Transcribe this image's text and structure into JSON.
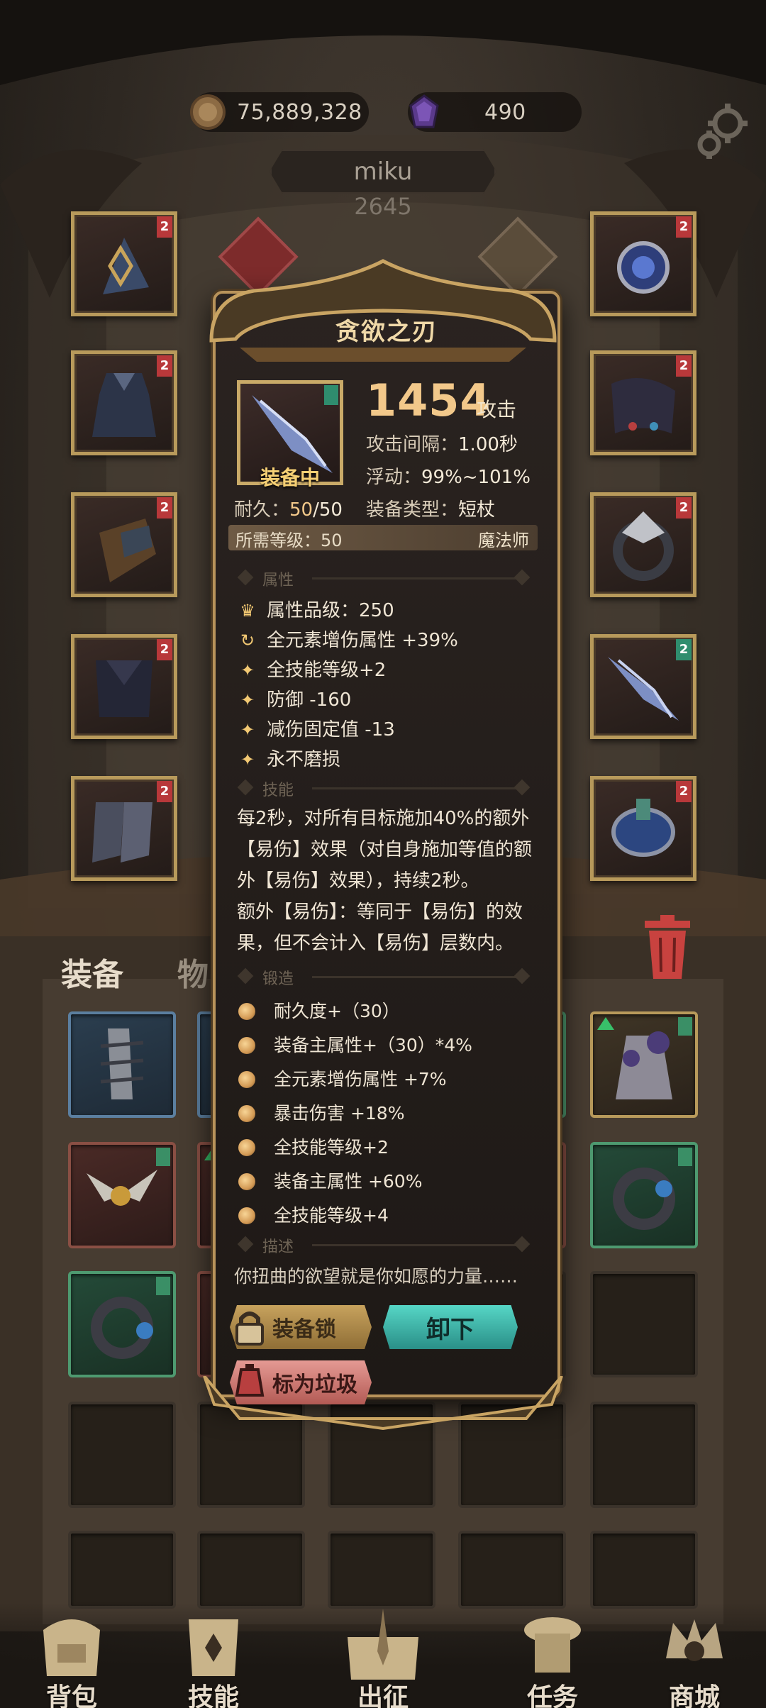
{
  "topbar": {
    "gold_amount": "75,889,328",
    "gem_amount": "490",
    "icons": [
      "gold-coin-icon",
      "purple-gem-icon",
      "gear-icon"
    ]
  },
  "player": {
    "name": "miku",
    "power": "2645"
  },
  "tabs": {
    "equipment": "装备",
    "items": "物品"
  },
  "item": {
    "name": "贪欲之刃",
    "attack_value": "1454",
    "attack_unit": "攻击",
    "equipped_label": "装备中",
    "attack_interval_label": "攻击间隔：",
    "attack_interval": "1.00秒",
    "float_label": "浮动：",
    "float_value": "99%~101%",
    "durability_label": "耐久：",
    "durability_current": "50",
    "durability_sep": "/",
    "durability_max": "50",
    "type_label": "装备类型：",
    "type_value": "短杖",
    "required_level_label": "所需等级：",
    "required_level": "50",
    "class": "魔法师",
    "sections": {
      "attributes": "属性",
      "skills": "技能",
      "forge": "锻造",
      "description": "描述"
    },
    "attributes": [
      {
        "icon": "quality-crest-icon",
        "text": "属性品级：250"
      },
      {
        "icon": "cycle-arrows-icon",
        "text": "全元素增伤属性 +39%"
      },
      {
        "icon": "sparkle-icon",
        "text": "全技能等级+2"
      },
      {
        "icon": "sparkle-icon",
        "text": "防御 -160"
      },
      {
        "icon": "sparkle-icon",
        "text": "减伤固定值 -13"
      },
      {
        "icon": "sparkle-icon",
        "text": "永不磨损"
      }
    ],
    "skill_lines": [
      "每2秒，对所有目标施加40%的额外",
      "【易伤】效果（对自身施加等值的额",
      "外【易伤】效果），持续2秒。",
      "额外【易伤】：等同于【易伤】的效",
      "果，但不会计入【易伤】层数内。"
    ],
    "forge_lines": [
      "耐久度+（30）",
      "装备主属性+（30）*4%",
      "全元素增伤属性 +7%",
      "暴击伤害 +18%",
      "全技能等级+2",
      "装备主属性 +60%",
      "全技能等级+4"
    ],
    "description": "你扭曲的欲望就是你如愿的力量……",
    "buttons": {
      "lock": "装备锁",
      "unequip": "卸下",
      "junk": "标为垃圾"
    }
  },
  "slots": {
    "level_badge": "2"
  },
  "bottom_nav": [
    {
      "label": "背包",
      "icon": "backpack-icon"
    },
    {
      "label": "技能",
      "icon": "skill-scroll-icon"
    },
    {
      "label": "出征",
      "icon": "sword-map-icon"
    },
    {
      "label": "任务",
      "icon": "quest-scroll-icon"
    },
    {
      "label": "商城",
      "icon": "shop-crown-icon"
    }
  ],
  "colors": {
    "panel_border": "#b8935a",
    "gold_text": "#f2c88a",
    "teal_button": "#56d6c6",
    "pink_button": "#e59a94",
    "lock_button": "#c7a25d"
  }
}
